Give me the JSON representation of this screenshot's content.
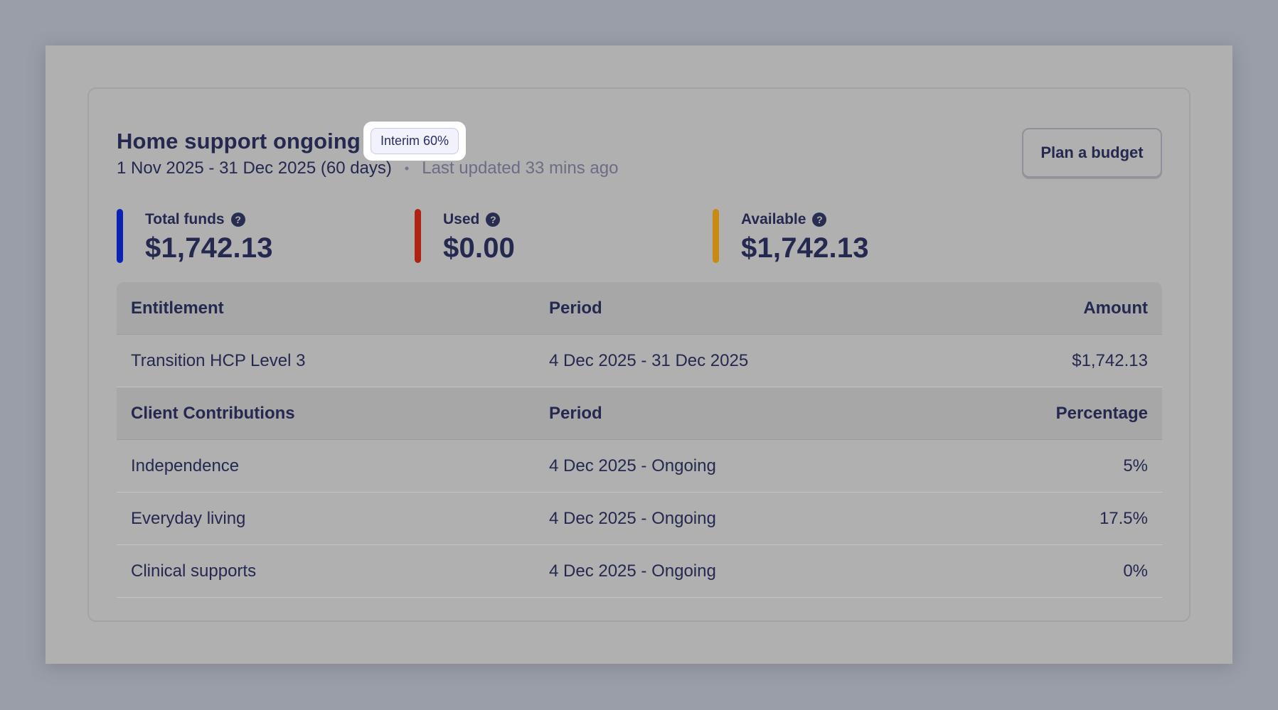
{
  "header": {
    "title": "Home support ongoing",
    "badge": "Interim 60%",
    "dates": "1 Nov 2025 - 31 Dec 2025 (60 days)",
    "separator": "•",
    "updated": "Last updated 33 mins ago",
    "plan_button": "Plan a budget"
  },
  "stats": [
    {
      "label": "Total funds",
      "value": "$1,742.13",
      "color": "#0b23b5"
    },
    {
      "label": "Used",
      "value": "$0.00",
      "color": "#b02313"
    },
    {
      "label": "Available",
      "value": "$1,742.13",
      "color": "#c98a12"
    }
  ],
  "help_icon_glyph": "?",
  "entitlement_table": {
    "headers": [
      "Entitlement",
      "Period",
      "Amount"
    ],
    "rows": [
      [
        "Transition HCP Level 3",
        "4 Dec 2025 - 31 Dec 2025",
        "$1,742.13"
      ]
    ]
  },
  "contributions_table": {
    "headers": [
      "Client Contributions",
      "Period",
      "Percentage"
    ],
    "rows": [
      [
        "Independence",
        "4 Dec 2025 - Ongoing",
        "5%"
      ],
      [
        "Everyday living",
        "4 Dec 2025 - Ongoing",
        "17.5%"
      ],
      [
        "Clinical supports",
        "4 Dec 2025 - Ongoing",
        "0%"
      ]
    ]
  }
}
